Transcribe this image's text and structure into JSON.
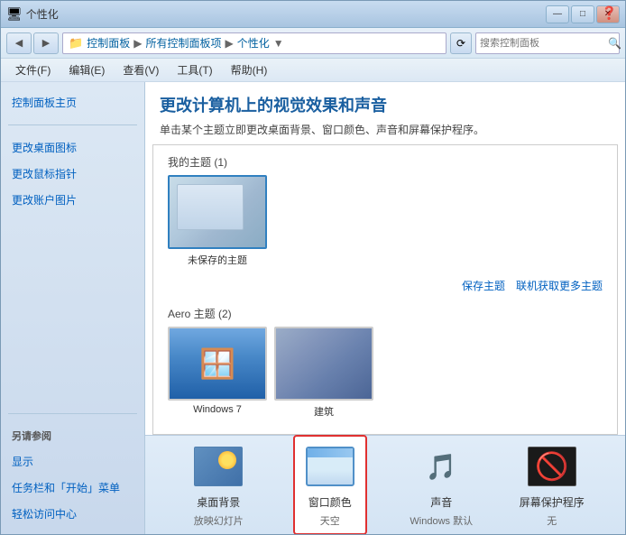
{
  "window": {
    "title": "个性化",
    "title_bar_buttons": {
      "minimize": "—",
      "maximize": "□",
      "close": "✕"
    }
  },
  "address_bar": {
    "nav_back": "◀",
    "nav_forward": "▶",
    "path_parts": [
      "控制面板",
      "所有控制面板项",
      "个性化"
    ],
    "refresh": "⟳",
    "search_placeholder": "搜索控制面板"
  },
  "menu": {
    "items": [
      "文件(F)",
      "编辑(E)",
      "查看(V)",
      "工具(T)",
      "帮助(H)"
    ]
  },
  "sidebar": {
    "main_links": [
      "控制面板主页",
      "更改桌面图标",
      "更改鼠标指针",
      "更改账户图片"
    ],
    "also_see_label": "另请参阅",
    "also_see_links": [
      "显示",
      "任务栏和「开始」菜单",
      "轻松访问中心"
    ]
  },
  "content": {
    "title": "更改计算机上的视觉效果和声音",
    "description": "单击某个主题立即更改桌面背景、窗口颜色、声音和屏幕保护程序。",
    "my_themes_label": "我的主题 (1)",
    "unsaved_theme_label": "未保存的主题",
    "save_theme_link": "保存主题",
    "online_themes_link": "联机获取更多主题",
    "aero_themes_label": "Aero 主题 (2)"
  },
  "bottom_bar": {
    "items": [
      {
        "label": "桌面背景",
        "sublabel": "放映幻灯片",
        "icon": "desktop-bg"
      },
      {
        "label": "窗口颜色",
        "sublabel": "天空",
        "icon": "window-color",
        "highlighted": true
      },
      {
        "label": "声音",
        "sublabel": "Windows 默认",
        "icon": "sound"
      },
      {
        "label": "屏幕保护程序",
        "sublabel": "无",
        "icon": "screen-saver"
      }
    ]
  }
}
